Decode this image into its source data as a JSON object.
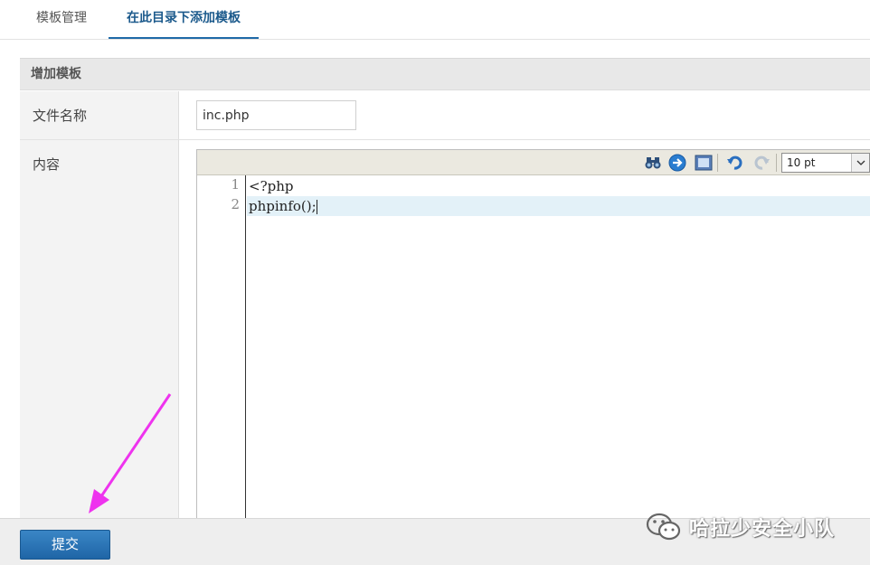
{
  "tabs": [
    {
      "label": "模板管理"
    },
    {
      "label": "在此目录下添加模板"
    }
  ],
  "panel": {
    "header": "增加模板",
    "filename_label": "文件名称",
    "content_label": "内容",
    "filename_value": "inc.php"
  },
  "editor": {
    "font_size": "10 pt",
    "lines": [
      {
        "number": "1",
        "text": "<?php"
      },
      {
        "number": "2",
        "text": "phpinfo();"
      }
    ],
    "active_line": 2,
    "toolbar_icons": [
      "find-icon",
      "goto-line-icon",
      "fullscreen-icon",
      "undo-icon",
      "redo-icon"
    ]
  },
  "actions": {
    "submit_label": "提交"
  },
  "watermark": {
    "text": "哈拉少安全小队"
  },
  "colors": {
    "active_tab": "#1c5a8c",
    "submit_button": "#2a72b4",
    "arrow": "#ee33ee",
    "active_line": "#e3f1f8"
  }
}
